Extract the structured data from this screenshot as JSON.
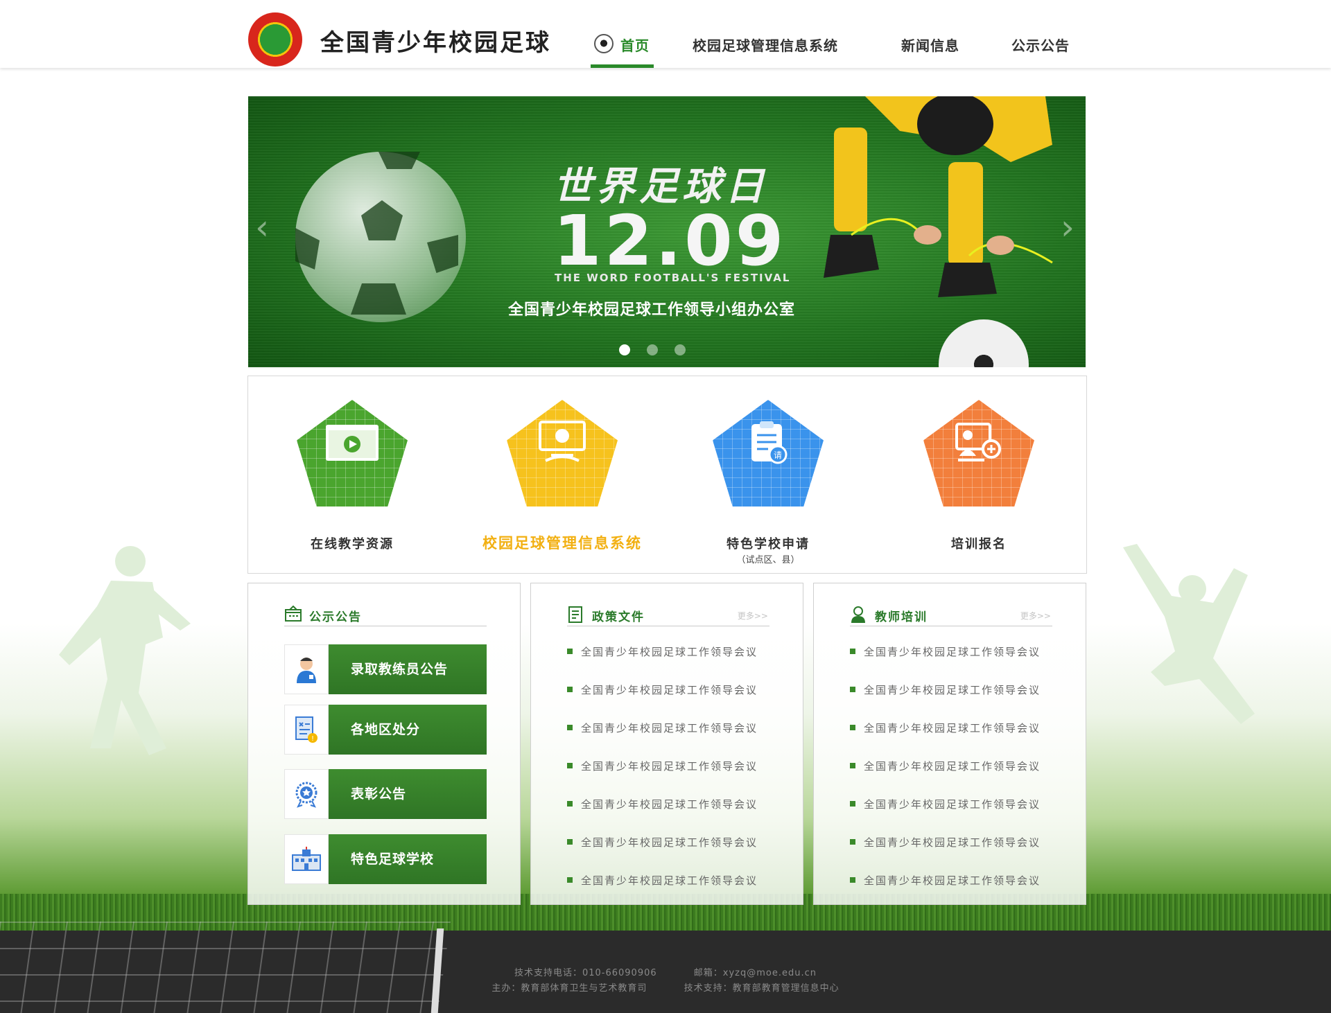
{
  "header": {
    "site_title": "全国青少年校园足球",
    "nav": [
      {
        "label": "首页",
        "active": true
      },
      {
        "label": "校园足球管理信息系统",
        "active": false
      },
      {
        "label": "新闻信息",
        "active": false
      },
      {
        "label": "公示公告",
        "active": false
      }
    ]
  },
  "banner": {
    "title": "世界足球日",
    "date": "12.09",
    "subtitle_en": "THE WORD FOOTBALL'S FESTIVAL",
    "subtitle": "全国青少年校园足球工作领导小组办公室",
    "active_slide": 1,
    "slide_count": 3
  },
  "quick_links": [
    {
      "label": "在线教学资源",
      "sub": "",
      "color": "#4aa52e",
      "icon": "video-play-icon"
    },
    {
      "label": "校园足球管理信息系统",
      "sub": "",
      "color": "#f6c21d",
      "icon": "monitor-soccer-icon"
    },
    {
      "label": "特色学校申请",
      "sub": "（试点区、县）",
      "color": "#3a93ec",
      "icon": "application-form-icon"
    },
    {
      "label": "培训报名",
      "sub": "",
      "color": "#f27f3c",
      "icon": "training-register-icon"
    }
  ],
  "notices": {
    "title": "公示公告",
    "buttons": [
      {
        "label": "录取教练员公告",
        "icon": "coach-icon"
      },
      {
        "label": "各地区处分",
        "icon": "penalty-document-icon"
      },
      {
        "label": "表彰公告",
        "icon": "award-medal-icon"
      },
      {
        "label": "特色足球学校",
        "icon": "school-building-icon"
      }
    ]
  },
  "policy": {
    "title": "政策文件",
    "more": "更多>>",
    "items": [
      "全国青少年校园足球工作领导会议",
      "全国青少年校园足球工作领导会议",
      "全国青少年校园足球工作领导会议",
      "全国青少年校园足球工作领导会议",
      "全国青少年校园足球工作领导会议",
      "全国青少年校园足球工作领导会议",
      "全国青少年校园足球工作领导会议"
    ]
  },
  "training": {
    "title": "教师培训",
    "more": "更多>>",
    "items": [
      "全国青少年校园足球工作领导会议",
      "全国青少年校园足球工作领导会议",
      "全国青少年校园足球工作领导会议",
      "全国青少年校园足球工作领导会议",
      "全国青少年校园足球工作领导会议",
      "全国青少年校园足球工作领导会议",
      "全国青少年校园足球工作领导会议"
    ]
  },
  "footer": {
    "phone": "技术支持电话：010-66090906",
    "email": "邮箱：xyzq@moe.edu.cn",
    "host": "主办：教育部体育卫生与艺术教育司",
    "support": "技术支持：教育部教育管理信息中心"
  },
  "colors": {
    "brand_green": "#2a8a2a",
    "accent_yellow": "#f2b012",
    "footer_bg": "#2b2b2b"
  }
}
